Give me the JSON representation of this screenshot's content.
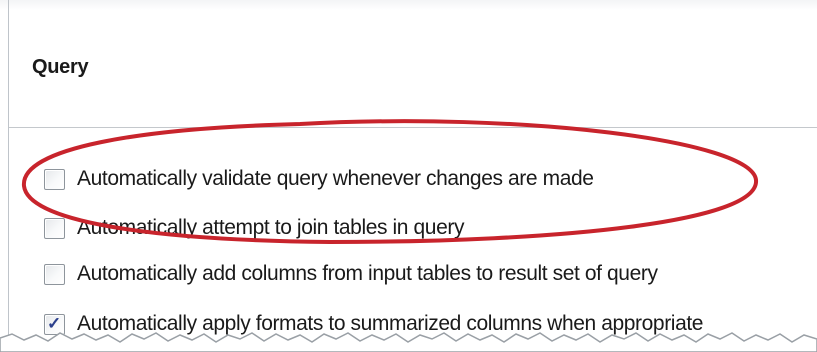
{
  "section": {
    "title": "Query"
  },
  "options": [
    {
      "label": "Automatically validate query whenever changes are made",
      "checked": false
    },
    {
      "label": "Automatically attempt to join tables in query",
      "checked": false
    },
    {
      "label": "Automatically add columns from input tables to result set of query",
      "checked": false
    },
    {
      "label": "Automatically apply formats to summarized columns when appropriate",
      "checked": true
    }
  ],
  "check_glyph": "✓",
  "annotation_color": "#c8242c"
}
